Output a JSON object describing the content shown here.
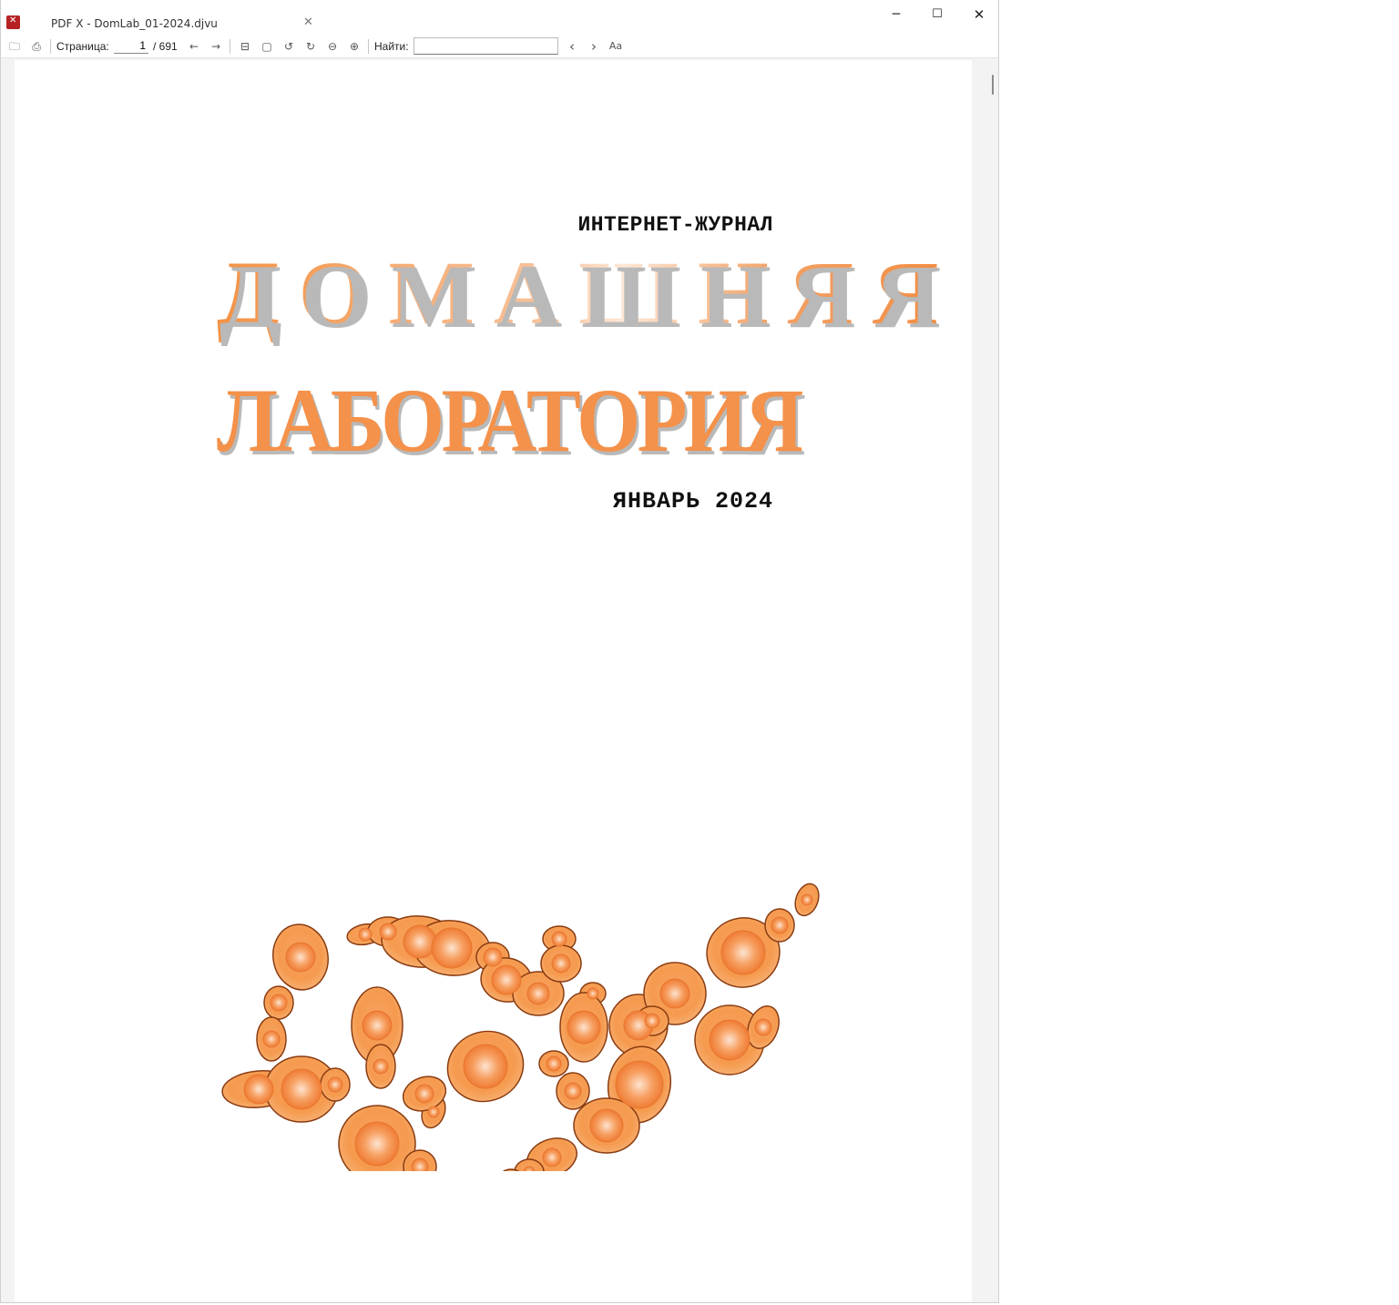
{
  "window": {
    "tab_title": "PDF X - DomLab_01-2024.djvu",
    "app_icon_text": "✕",
    "tab_close": "✕",
    "minimize": "─",
    "maximize": "☐",
    "close": "✕"
  },
  "toolbar": {
    "page_label": "Страница:",
    "page_current": "1",
    "page_total": "/ 691",
    "find_label": "Найти:",
    "find_value": "",
    "icons": {
      "open": "🗀",
      "print": "⎙",
      "prev_page": "←",
      "next_page": "→",
      "fit_width": "⊟",
      "fit_page": "▢",
      "rotate_left": "↺",
      "rotate_right": "↻",
      "zoom_out": "⊖",
      "zoom_in": "⊕",
      "find_prev": "‹",
      "find_next": "›",
      "match_case": "Aa"
    }
  },
  "document": {
    "subtitle": "ИНТЕРНЕТ-ЖУРНАЛ",
    "title_line1": "ДОМАШНЯЯ",
    "title_line2": "ЛАБОРАТОРИЯ",
    "date": "ЯНВАРЬ 2024"
  },
  "colors": {
    "accent_orange": "#f4914a",
    "cell_outline": "#8a3b10",
    "app_icon": "#b62224"
  }
}
